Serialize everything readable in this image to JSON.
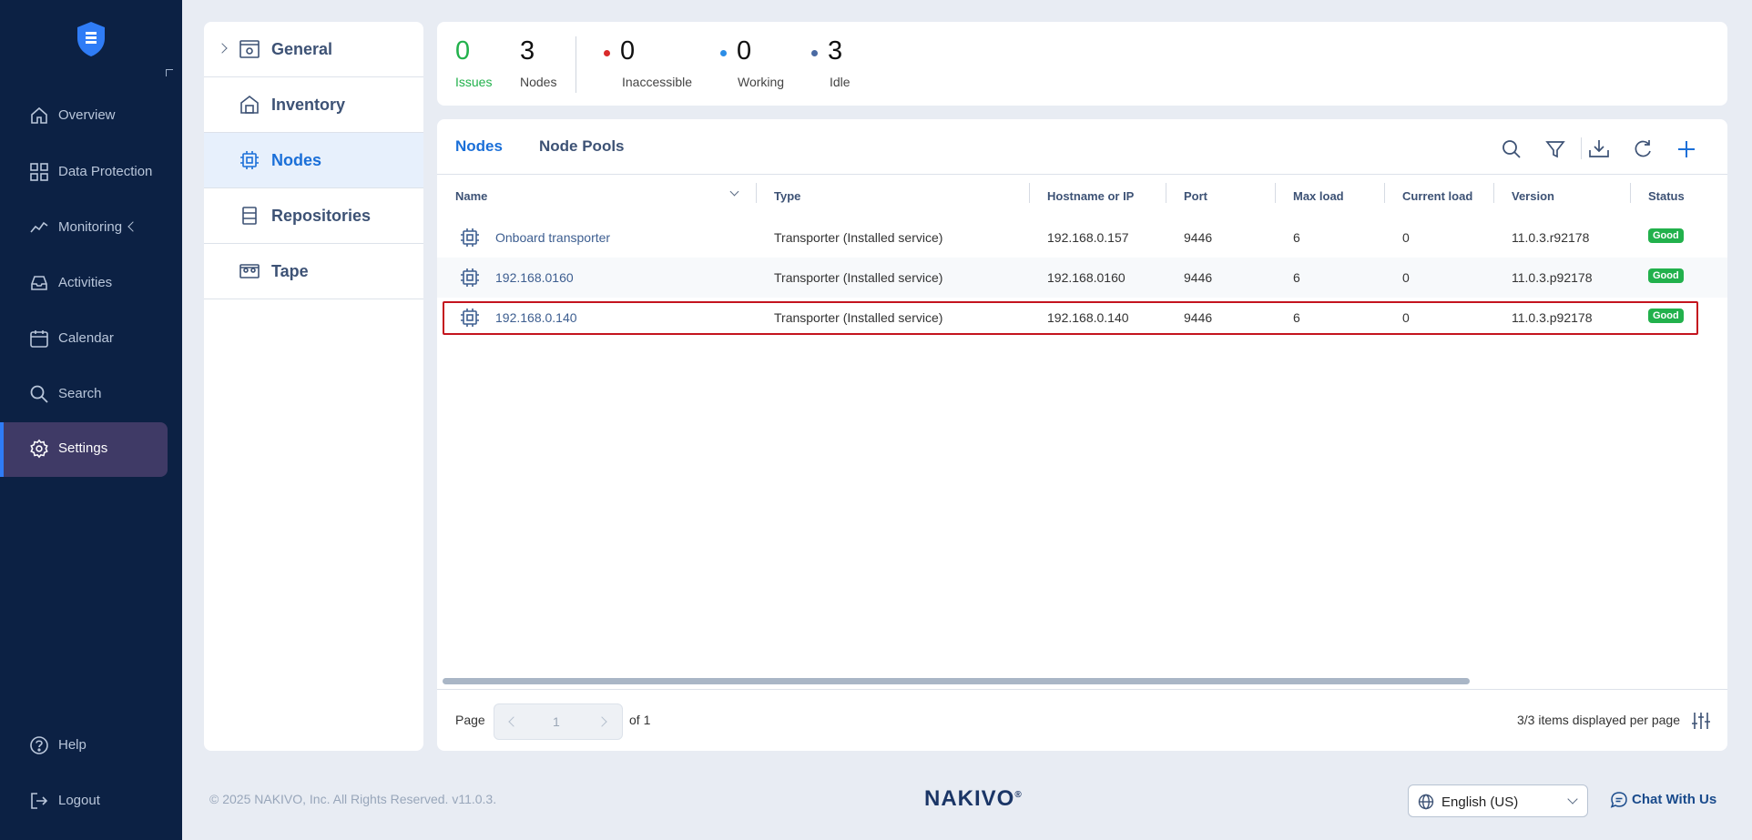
{
  "sidebar": {
    "items": [
      {
        "label": "Overview",
        "icon": "home-icon"
      },
      {
        "label": "Data Protection",
        "icon": "grid-icon"
      },
      {
        "label": "Monitoring",
        "icon": "activity-icon"
      },
      {
        "label": "Activities",
        "icon": "inbox-icon"
      },
      {
        "label": "Calendar",
        "icon": "calendar-icon"
      },
      {
        "label": "Search",
        "icon": "search-icon"
      },
      {
        "label": "Settings",
        "icon": "gear-icon",
        "active": true
      }
    ],
    "bottom": [
      {
        "label": "Help",
        "icon": "help-icon"
      },
      {
        "label": "Logout",
        "icon": "logout-icon"
      }
    ]
  },
  "settings_menu": {
    "items": [
      {
        "label": "General",
        "icon": "general-settings-icon"
      },
      {
        "label": "Inventory",
        "icon": "inventory-icon"
      },
      {
        "label": "Nodes",
        "icon": "node-chip-icon",
        "active": true
      },
      {
        "label": "Repositories",
        "icon": "repository-icon"
      },
      {
        "label": "Tape",
        "icon": "tape-icon"
      }
    ]
  },
  "summary": {
    "issues": {
      "value": "0",
      "label": "Issues"
    },
    "nodes": {
      "value": "3",
      "label": "Nodes"
    },
    "inaccessible": {
      "value": "0",
      "label": "Inaccessible"
    },
    "working": {
      "value": "0",
      "label": "Working"
    },
    "idle": {
      "value": "3",
      "label": "Idle"
    }
  },
  "tabs": [
    {
      "label": "Nodes",
      "active": true
    },
    {
      "label": "Node Pools"
    }
  ],
  "table": {
    "columns": [
      "Name",
      "Type",
      "Hostname or IP",
      "Port",
      "Max load",
      "Current load",
      "Version",
      "Status"
    ],
    "rows": [
      {
        "name": "Onboard transporter",
        "type": "Transporter (Installed service)",
        "host": "192.168.0.157",
        "port": "9446",
        "max_load": "6",
        "current_load": "0",
        "version": "11.0.3.r92178",
        "status": "Good"
      },
      {
        "name": "192.168.0160",
        "type": "Transporter (Installed service)",
        "host": "192.168.0160",
        "port": "9446",
        "max_load": "6",
        "current_load": "0",
        "version": "11.0.3.p92178",
        "status": "Good"
      },
      {
        "name": "192.168.0.140",
        "type": "Transporter (Installed service)",
        "host": "192.168.0.140",
        "port": "9446",
        "max_load": "6",
        "current_load": "0",
        "version": "11.0.3.p92178",
        "status": "Good"
      }
    ]
  },
  "pagination": {
    "label": "Page",
    "value": "1",
    "of": "of 1",
    "per_page": "3/3 items displayed per page"
  },
  "footer": {
    "copyright": "© 2025 NAKIVO, Inc. All Rights Reserved. v11.0.3.",
    "brand": "NAKIVO",
    "brand_mark": "®",
    "language": "English (US)",
    "chat": "Chat With Us"
  },
  "colors": {
    "sidebar_bg": "#0c2144",
    "accent": "#1a6fd8",
    "good": "#22b14c",
    "issues": "#22b14c",
    "inaccessible": "#d92b2b",
    "working": "#2b8de6",
    "idle": "#4a6aa3",
    "highlight": "#c4141e"
  }
}
